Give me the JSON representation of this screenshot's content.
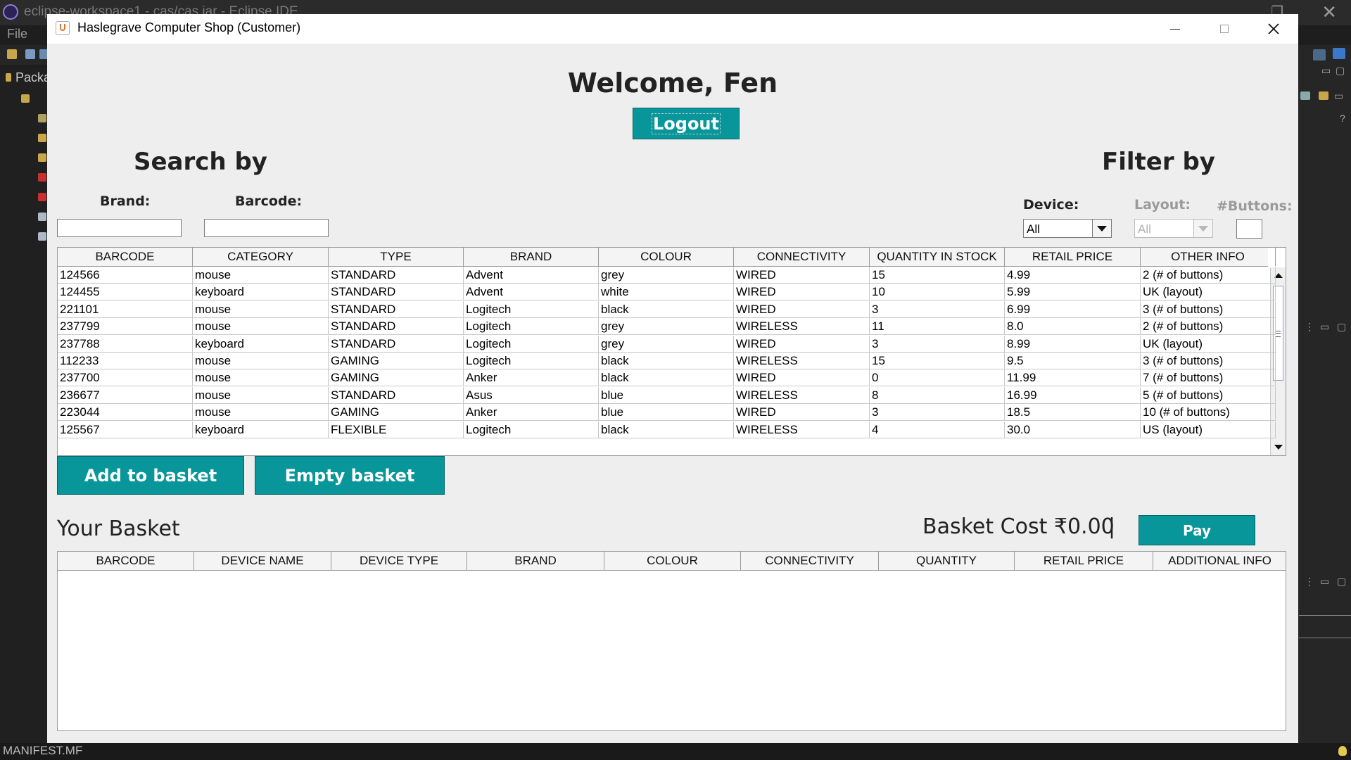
{
  "ide": {
    "title": "eclipse-workspace1 - cas/cas.jar - Eclipse IDE",
    "menu_file": "File",
    "explorer_label": "Packa",
    "status_file": "MANIFEST.MF"
  },
  "window": {
    "title": "Haslegrave Computer Shop (Customer)"
  },
  "header": {
    "welcome": "Welcome, Fen",
    "logout_label": "Logout"
  },
  "search": {
    "heading": "Search by",
    "brand_label": "Brand:",
    "brand_value": "",
    "barcode_label": "Barcode:",
    "barcode_value": ""
  },
  "filter": {
    "heading": "Filter by",
    "device_label": "Device:",
    "device_value": "All",
    "layout_label": "Layout:",
    "layout_value": "All",
    "buttons_label": "#Buttons:",
    "buttons_value": ""
  },
  "stock_table": {
    "columns": [
      "BARCODE",
      "CATEGORY",
      "TYPE",
      "BRAND",
      "COLOUR",
      "CONNECTIVITY",
      "QUANTITY IN STOCK",
      "RETAIL PRICE",
      "OTHER INFO"
    ],
    "rows": [
      [
        "124566",
        "mouse",
        "STANDARD",
        "Advent",
        "grey",
        "WIRED",
        "15",
        "4.99",
        "2 (# of buttons)"
      ],
      [
        "124455",
        "keyboard",
        "STANDARD",
        "Advent",
        "white",
        "WIRED",
        "10",
        "5.99",
        "UK (layout)"
      ],
      [
        "221101",
        "mouse",
        "STANDARD",
        "Logitech",
        "black",
        "WIRED",
        "3",
        "6.99",
        "3 (# of buttons)"
      ],
      [
        "237799",
        "mouse",
        "STANDARD",
        "Logitech",
        "grey",
        "WIRELESS",
        "11",
        "8.0",
        "2 (# of buttons)"
      ],
      [
        "237788",
        "keyboard",
        "STANDARD",
        "Logitech",
        "grey",
        "WIRED",
        "3",
        "8.99",
        "UK (layout)"
      ],
      [
        "112233",
        "mouse",
        "GAMING",
        "Logitech",
        "black",
        "WIRELESS",
        "15",
        "9.5",
        "3 (# of buttons)"
      ],
      [
        "237700",
        "mouse",
        "GAMING",
        "Anker",
        "black",
        "WIRED",
        "0",
        "11.99",
        "7 (# of buttons)"
      ],
      [
        "236677",
        "mouse",
        "STANDARD",
        "Asus",
        "blue",
        "WIRELESS",
        "8",
        "16.99",
        "5 (# of buttons)"
      ],
      [
        "223044",
        "mouse",
        "GAMING",
        "Anker",
        "blue",
        "WIRED",
        "3",
        "18.5",
        "10 (# of buttons)"
      ],
      [
        "125567",
        "keyboard",
        "FLEXIBLE",
        "Logitech",
        "black",
        "WIRELESS",
        "4",
        "30.0",
        "US (layout)"
      ]
    ]
  },
  "actions": {
    "add_label": "Add to basket",
    "empty_label": "Empty basket"
  },
  "basket": {
    "title": "Your Basket",
    "cost": "Basket Cost ₹0.00",
    "separator": "|",
    "pay_label": "Pay",
    "columns": [
      "BARCODE",
      "DEVICE NAME",
      "DEVICE TYPE",
      "BRAND",
      "COLOUR",
      "CONNECTIVITY",
      "QUANTITY",
      "RETAIL PRICE",
      "ADDITIONAL INFO"
    ],
    "rows": []
  },
  "colors": {
    "accent": "#09969a",
    "window_bg": "#eeeeee"
  }
}
